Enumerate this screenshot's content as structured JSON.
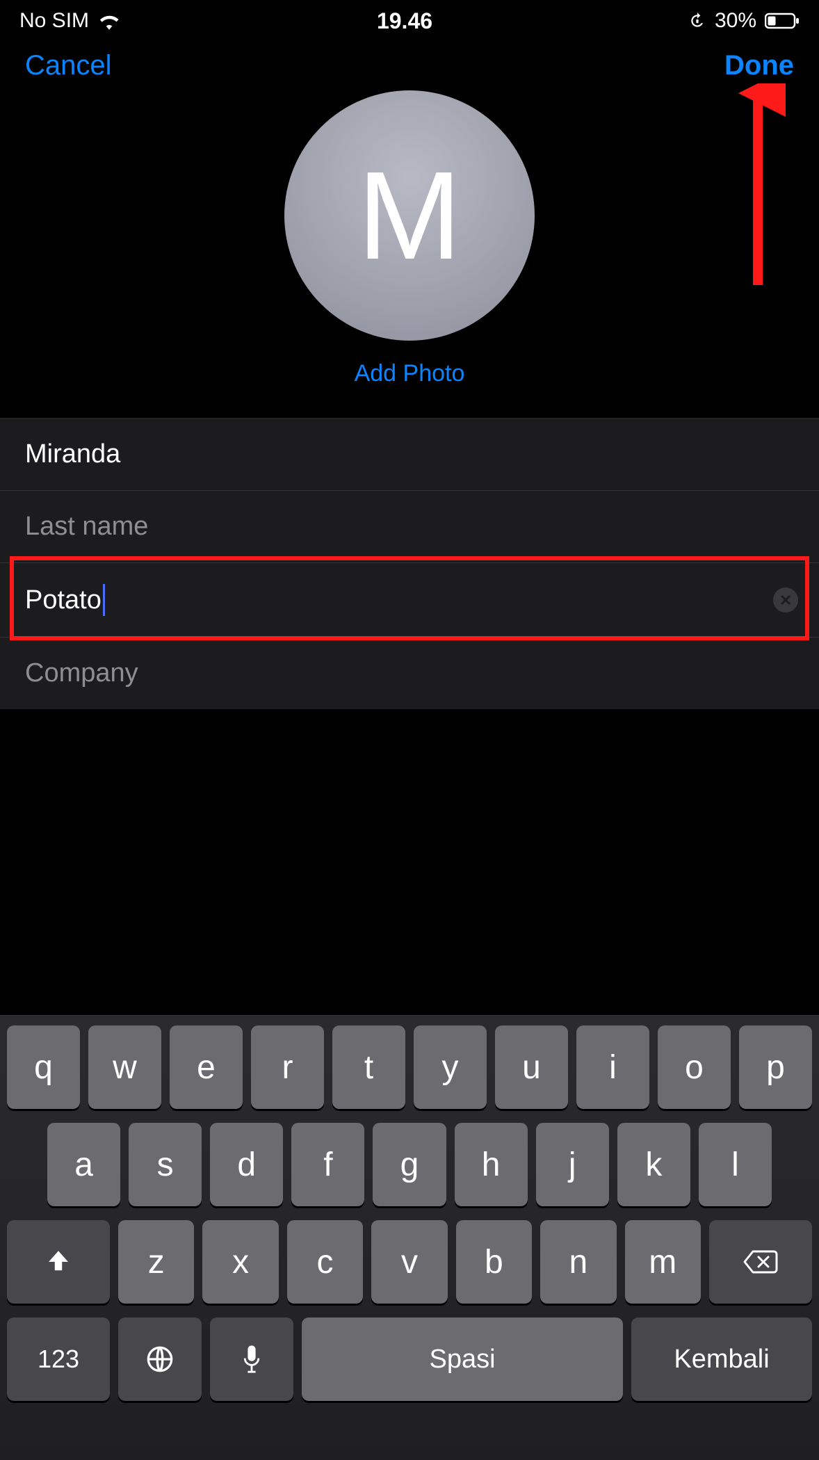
{
  "status": {
    "carrier": "No SIM",
    "time": "19.46",
    "battery_pct": "30%"
  },
  "nav": {
    "cancel": "Cancel",
    "done": "Done"
  },
  "contact": {
    "avatar_initial": "M",
    "add_photo": "Add Photo",
    "first_name_value": "Miranda",
    "last_name_placeholder": "Last name",
    "nickname_value": "Potato",
    "company_placeholder": "Company"
  },
  "keyboard": {
    "row1": [
      "q",
      "w",
      "e",
      "r",
      "t",
      "y",
      "u",
      "i",
      "o",
      "p"
    ],
    "row2": [
      "a",
      "s",
      "d",
      "f",
      "g",
      "h",
      "j",
      "k",
      "l"
    ],
    "row3": [
      "z",
      "x",
      "c",
      "v",
      "b",
      "n",
      "m"
    ],
    "numbers_key": "123",
    "space_key": "Spasi",
    "return_key": "Kembali"
  }
}
